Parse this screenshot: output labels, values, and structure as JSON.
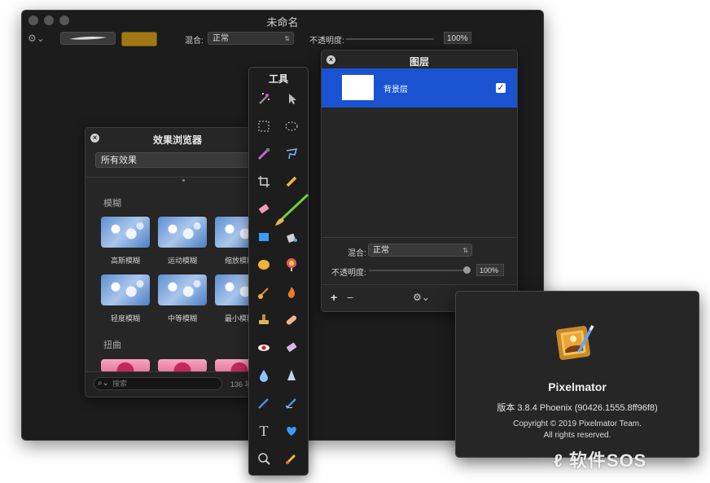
{
  "main_window": {
    "title": "未命名",
    "blend_label": "混合:",
    "blend_value": "正常",
    "opacity_label": "不透明度:",
    "opacity_value": "100%",
    "brush_color": "#a17813"
  },
  "effects_browser": {
    "title": "效果浏览器",
    "category_select": "所有效果",
    "groups": [
      {
        "label": "模糊",
        "items": [
          "高斯模糊",
          "运动模糊",
          "缩放模糊",
          "轻度模糊",
          "中等模糊",
          "最小模糊"
        ]
      },
      {
        "label": "扭曲"
      }
    ],
    "search_placeholder": "搜索",
    "count": "136 项"
  },
  "tools_palette": {
    "title": "工具",
    "tools": [
      "magic-wand",
      "arrange-pointer",
      "rect-select",
      "ellipse-select",
      "color-picker",
      "lasso",
      "crop",
      "pencil",
      "eraser",
      "brush",
      "shape",
      "fill-bucket",
      "sponge",
      "gradient",
      "smudge",
      "burn",
      "stamp",
      "bandage",
      "red-eye",
      "light-eraser",
      "blur-drop",
      "sharpen",
      "pen",
      "freeform-pen",
      "type",
      "heart-shape",
      "zoom",
      "color-sample"
    ]
  },
  "layers_panel": {
    "title": "图层",
    "layers": [
      {
        "name": "背景层",
        "visible": true,
        "selected": true
      }
    ],
    "blend_label": "混合:",
    "blend_value": "正常",
    "opacity_label": "不透明度:",
    "opacity_value": "100%",
    "add_label": "+",
    "remove_label": "−",
    "gear_label": "⚙︎⌄"
  },
  "about_window": {
    "app_name": "Pixelmator",
    "version": "版本 3.8.4 Phoenix (90426.1555.8ff96f8)",
    "copyright_line1": "Copyright © 2019 Pixelmator Team.",
    "copyright_line2": "All rights reserved."
  },
  "watermark": "软件SOS",
  "colors": {
    "accent_selection": "#1a53d2",
    "panel_bg": "#262626",
    "window_bg": "#1c1c1c"
  }
}
